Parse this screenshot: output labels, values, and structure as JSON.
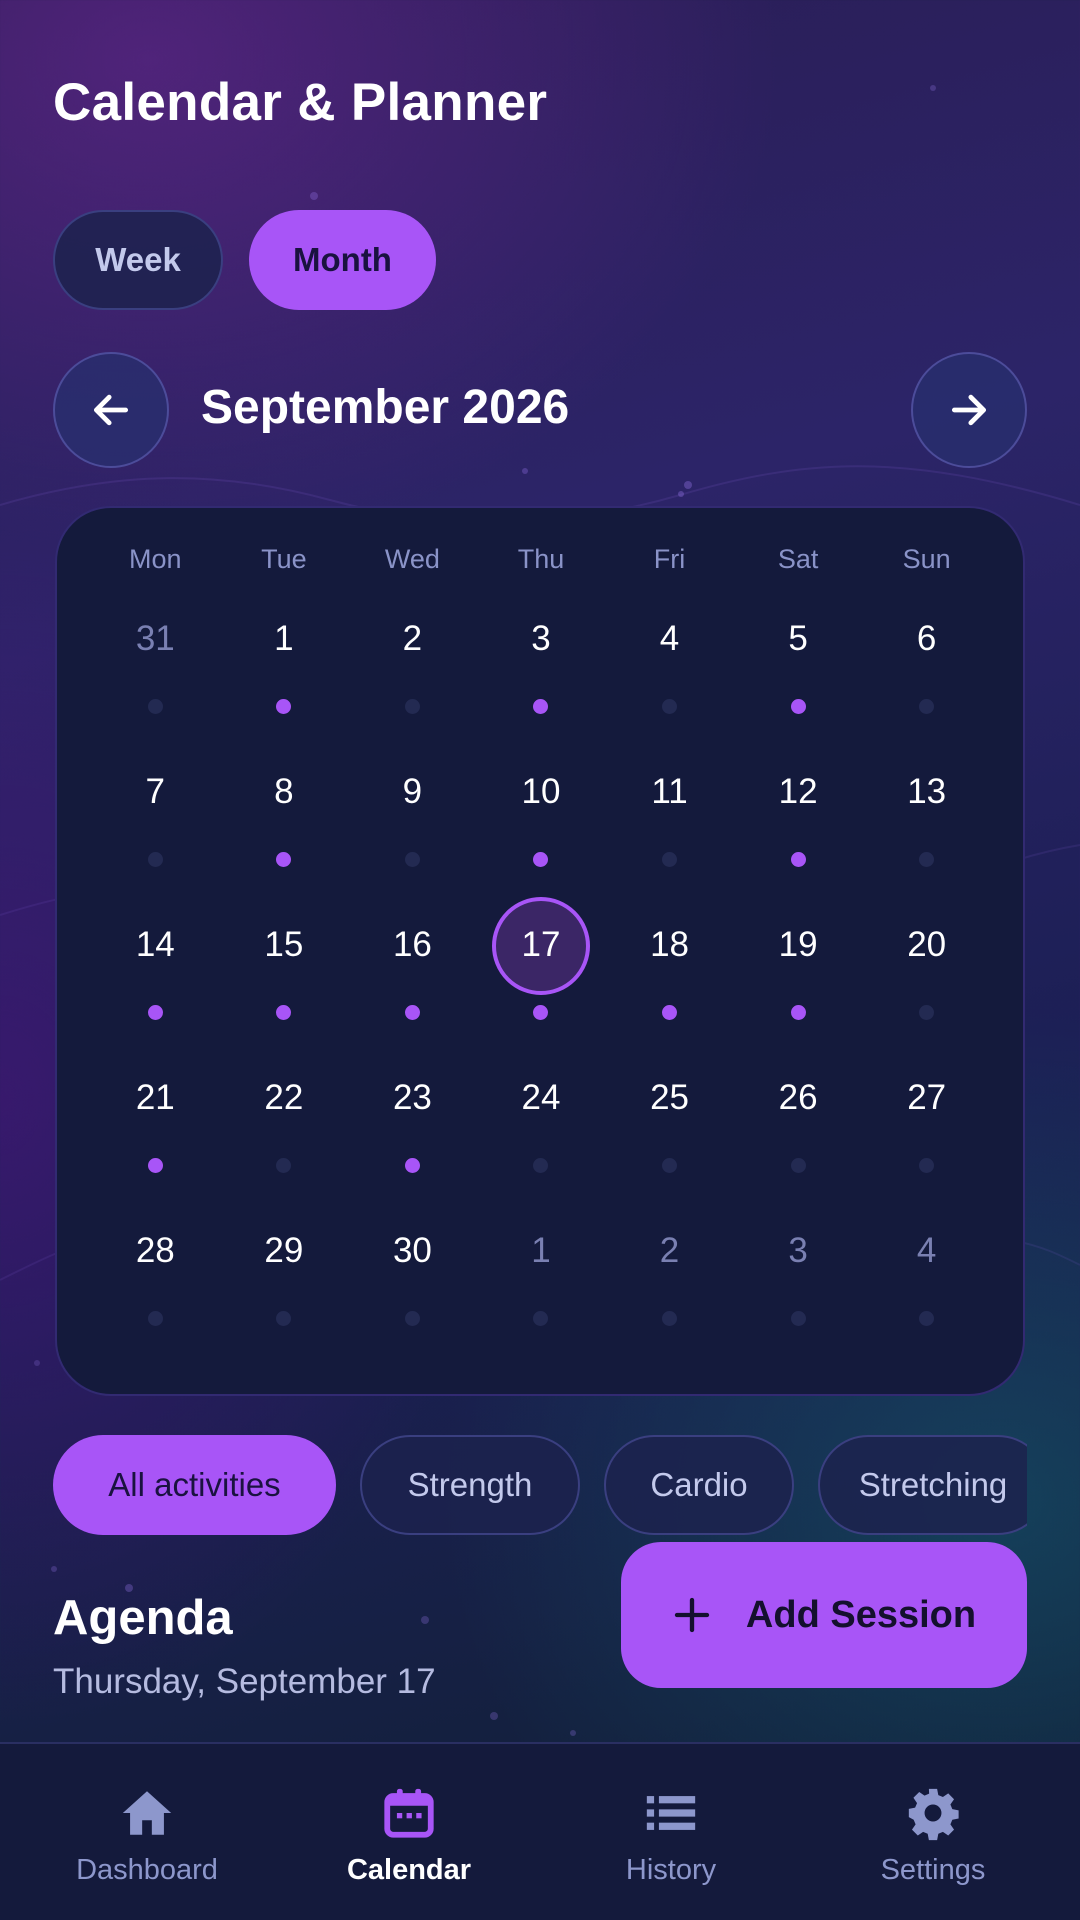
{
  "header": {
    "title": "Calendar & Planner"
  },
  "view_toggle": {
    "week_label": "Week",
    "month_label": "Month",
    "selected": "Month"
  },
  "month_nav": {
    "label": "September 2026",
    "prev_icon": "arrow-left-icon",
    "next_icon": "arrow-right-icon"
  },
  "calendar": {
    "weekdays": [
      "Mon",
      "Tue",
      "Wed",
      "Thu",
      "Fri",
      "Sat",
      "Sun"
    ],
    "selected_day": "17",
    "days": [
      {
        "n": "31",
        "muted": true,
        "event": false
      },
      {
        "n": "1",
        "muted": false,
        "event": true
      },
      {
        "n": "2",
        "muted": false,
        "event": false
      },
      {
        "n": "3",
        "muted": false,
        "event": true
      },
      {
        "n": "4",
        "muted": false,
        "event": false
      },
      {
        "n": "5",
        "muted": false,
        "event": true
      },
      {
        "n": "6",
        "muted": false,
        "event": false
      },
      {
        "n": "7",
        "muted": false,
        "event": false
      },
      {
        "n": "8",
        "muted": false,
        "event": true
      },
      {
        "n": "9",
        "muted": false,
        "event": false
      },
      {
        "n": "10",
        "muted": false,
        "event": true
      },
      {
        "n": "11",
        "muted": false,
        "event": false
      },
      {
        "n": "12",
        "muted": false,
        "event": true
      },
      {
        "n": "13",
        "muted": false,
        "event": false
      },
      {
        "n": "14",
        "muted": false,
        "event": true
      },
      {
        "n": "15",
        "muted": false,
        "event": true
      },
      {
        "n": "16",
        "muted": false,
        "event": true
      },
      {
        "n": "17",
        "muted": false,
        "event": true,
        "selected": true
      },
      {
        "n": "18",
        "muted": false,
        "event": true
      },
      {
        "n": "19",
        "muted": false,
        "event": true
      },
      {
        "n": "20",
        "muted": false,
        "event": false
      },
      {
        "n": "21",
        "muted": false,
        "event": true
      },
      {
        "n": "22",
        "muted": false,
        "event": false
      },
      {
        "n": "23",
        "muted": false,
        "event": true
      },
      {
        "n": "24",
        "muted": false,
        "event": false
      },
      {
        "n": "25",
        "muted": false,
        "event": false
      },
      {
        "n": "26",
        "muted": false,
        "event": false
      },
      {
        "n": "27",
        "muted": false,
        "event": false
      },
      {
        "n": "28",
        "muted": false,
        "event": false
      },
      {
        "n": "29",
        "muted": false,
        "event": false
      },
      {
        "n": "30",
        "muted": false,
        "event": false
      },
      {
        "n": "1",
        "muted": true,
        "event": false
      },
      {
        "n": "2",
        "muted": true,
        "event": false
      },
      {
        "n": "3",
        "muted": true,
        "event": false
      },
      {
        "n": "4",
        "muted": true,
        "event": false
      }
    ]
  },
  "filters": {
    "items": [
      "All activities",
      "Strength",
      "Cardio",
      "Stretching"
    ],
    "selected": "All activities"
  },
  "agenda": {
    "title": "Agenda",
    "date": "Thursday, September 17"
  },
  "fab": {
    "label": "Add Session",
    "icon": "plus-icon"
  },
  "bottom_nav": {
    "items": [
      {
        "label": "Dashboard",
        "icon": "home-icon"
      },
      {
        "label": "Calendar",
        "icon": "calendar-icon"
      },
      {
        "label": "History",
        "icon": "list-icon"
      },
      {
        "label": "Settings",
        "icon": "gear-icon"
      }
    ],
    "selected": "Calendar"
  },
  "colors": {
    "accent": "#a855f7",
    "card": "#141a3c",
    "muted_text": "#8a93c8",
    "event_dot_off": "#232a52"
  }
}
